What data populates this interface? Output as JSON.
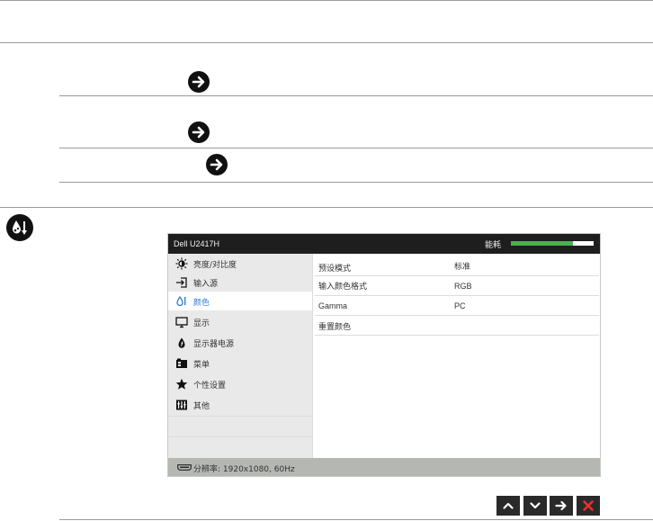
{
  "osd": {
    "title": "Dell U2417H",
    "energy_label": "能耗",
    "energy_level": 0.75,
    "menu": [
      {
        "label": "亮度/对比度",
        "icon": "brightness-icon",
        "active": false
      },
      {
        "label": "输入源",
        "icon": "input-source-icon",
        "active": false
      },
      {
        "label": "颜色",
        "icon": "color-icon",
        "active": true
      },
      {
        "label": "显示",
        "icon": "display-icon",
        "active": false
      },
      {
        "label": "显示器电源",
        "icon": "power-icon",
        "active": false
      },
      {
        "label": "菜单",
        "icon": "menu-icon",
        "active": false
      },
      {
        "label": "个性设置",
        "icon": "star-icon",
        "active": false
      },
      {
        "label": "其他",
        "icon": "other-icon",
        "active": false
      }
    ],
    "settings": [
      {
        "name": "预设模式",
        "value": "标准"
      },
      {
        "name": "输入颜色格式",
        "value": "RGB"
      },
      {
        "name": "Gamma",
        "value": "PC"
      },
      {
        "name": "重置颜色",
        "value": ""
      }
    ],
    "footer": {
      "resolution_text": "分辨率: 1920x1080, 60Hz"
    }
  },
  "colors": {
    "accent": "#2d7fd3",
    "energy": "#4bb14e",
    "header": "#1e1e1e",
    "sidebar": "#e9e9e9",
    "footer": "#b5b7b3",
    "close": "#e8302e"
  },
  "nav_buttons": [
    "up-icon",
    "down-icon",
    "right-arrow-icon",
    "close-icon"
  ]
}
